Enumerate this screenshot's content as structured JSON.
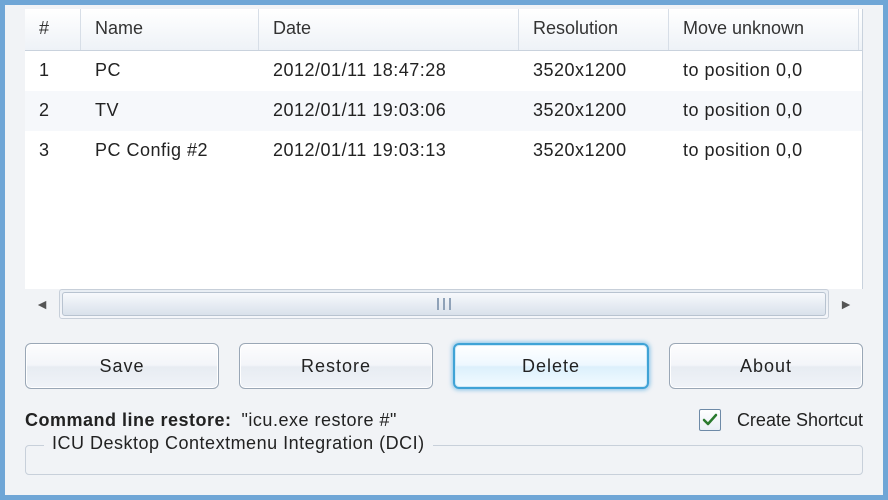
{
  "table": {
    "columns": [
      {
        "key": "idx",
        "label": "#"
      },
      {
        "key": "name",
        "label": "Name"
      },
      {
        "key": "date",
        "label": "Date"
      },
      {
        "key": "res",
        "label": "Resolution"
      },
      {
        "key": "move",
        "label": "Move unknown"
      }
    ],
    "rows": [
      {
        "idx": "1",
        "name": "PC",
        "date": "2012/01/11 18:47:28",
        "res": "3520x1200",
        "move": "to position 0,0"
      },
      {
        "idx": "2",
        "name": "TV",
        "date": "2012/01/11 19:03:06",
        "res": "3520x1200",
        "move": "to position 0,0"
      },
      {
        "idx": "3",
        "name": "PC Config #2",
        "date": "2012/01/11 19:03:13",
        "res": "3520x1200",
        "move": "to position 0,0"
      }
    ]
  },
  "buttons": {
    "save": "Save",
    "restore": "Restore",
    "delete": "Delete",
    "about": "About"
  },
  "cmdline": {
    "label": "Command line restore:",
    "value": "\"icu.exe restore #\"",
    "shortcut_label": "Create Shortcut",
    "shortcut_checked": true
  },
  "groupbox": {
    "title": "ICU Desktop Contextmenu Integration (DCI)"
  }
}
